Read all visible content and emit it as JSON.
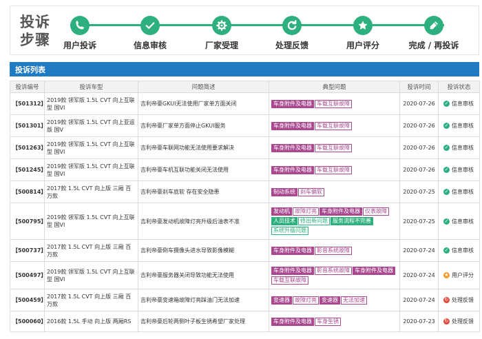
{
  "process": {
    "title": "投诉步骤",
    "steps": [
      {
        "label": "用户投诉",
        "icon": "phone-icon"
      },
      {
        "label": "信息审核",
        "icon": "check-icon"
      },
      {
        "label": "厂家受理",
        "icon": "gear-icon"
      },
      {
        "label": "处理反馈",
        "icon": "refresh-icon"
      },
      {
        "label": "用户评分",
        "icon": "star-icon"
      },
      {
        "label": "完成 / 再投诉",
        "icon": "pen-icon"
      }
    ]
  },
  "list": {
    "title": "投诉列表",
    "columns": [
      "投诉编号",
      "投诉车型",
      "问题简述",
      "典型问题",
      "投诉时间",
      "投诉状态"
    ],
    "rows": [
      {
        "id": "【501312】",
        "model": "2019款 领军版 1.5L CVT 向上互联型 国VI",
        "issue": "吉利帝豪GKUI无法使用厂家单方面关闭",
        "tags": [
          {
            "text": "车身附件及电器",
            "style": "solid"
          },
          {
            "text": "车载互联故障",
            "style": "outline"
          }
        ],
        "time": "2020-07-26",
        "status": "信息审核",
        "status_type": "ok"
      },
      {
        "id": "【501301】",
        "model": "2019款 领军版 1.5L CVT 向上亚运版 国V",
        "issue": "吉利帝豪厂家单方面停止GKUI服务",
        "tags": [
          {
            "text": "车身附件及电器",
            "style": "solid"
          },
          {
            "text": "车载互联故障",
            "style": "outline"
          }
        ],
        "time": "2020-07-26",
        "status": "信息审核",
        "status_type": "ok"
      },
      {
        "id": "【501263】",
        "model": "2019款 领军版 1.5L CVT 向上互联型 国VI",
        "issue": "吉利帝豪车联网功能无法使用要求解决",
        "tags": [
          {
            "text": "车身附件及电器",
            "style": "solid"
          },
          {
            "text": "车载互联故障",
            "style": "outline"
          }
        ],
        "time": "2020-07-26",
        "status": "信息审核",
        "status_type": "ok"
      },
      {
        "id": "【501245】",
        "model": "2019款 领军版 1.5L CVT 向上互联型 国VI",
        "issue": "吉利帝豪车机互联功能关闭无法使用",
        "tags": [
          {
            "text": "车身附件及电器",
            "style": "solid"
          },
          {
            "text": "车载互联故障",
            "style": "outline"
          }
        ],
        "time": "2020-07-26",
        "status": "信息审核",
        "status_type": "ok"
      },
      {
        "id": "【500814】",
        "model": "2017款 1.5L CVT 向上版 三厢 百万款",
        "issue": "吉利帝豪刹车底软 存在安全隐患",
        "tags": [
          {
            "text": "制动系统",
            "style": "solid"
          },
          {
            "text": "刹车偏软",
            "style": "outline"
          }
        ],
        "time": "2020-07-25",
        "status": "信息审核",
        "status_type": "ok"
      },
      {
        "id": "【500795】",
        "model": "2019款 领军版 1.5L CVT 向上互联型 国VI",
        "issue": "吉利帝豪发动机故障灯亮升级后油表不准",
        "tags": [
          {
            "text": "发动机",
            "style": "solid"
          },
          {
            "text": "故障灯亮",
            "style": "outline"
          },
          {
            "text": "车身附件及电器",
            "style": "solid"
          },
          {
            "text": "仪表故障",
            "style": "outline"
          },
          {
            "text": "人员技术",
            "style": "green-solid"
          },
          {
            "text": "修出新问题",
            "style": "green-outline"
          },
          {
            "text": "服务流程不完善",
            "style": "green-solid"
          },
          {
            "text": "系统升级问题",
            "style": "green-outline"
          }
        ],
        "time": "2020-07-25",
        "status": "信息审核",
        "status_type": "ok"
      },
      {
        "id": "【500737】",
        "model": "2017款 1.5L CVT 向上版 三厢 百万款",
        "issue": "吉利帝豪倒车摄像头进水导致影像模糊",
        "tags": [
          {
            "text": "车身附件及电器",
            "style": "solid"
          },
          {
            "text": "影音系统故障",
            "style": "outline"
          }
        ],
        "time": "2020-07-24",
        "status": "信息审核",
        "status_type": "ok"
      },
      {
        "id": "【500497】",
        "model": "2019款 领军版 1.5L CVT 向上互联型 国VI",
        "issue": "吉利帝豪服务器关闭导致功能无法使用",
        "tags": [
          {
            "text": "车身附件及电器",
            "style": "solid"
          },
          {
            "text": "影音系统故障",
            "style": "outline"
          },
          {
            "text": "车身附件及电器",
            "style": "solid"
          },
          {
            "text": "车载互联故障",
            "style": "outline"
          }
        ],
        "time": "2020-07-24",
        "status": "用户评分",
        "status_type": "rate"
      },
      {
        "id": "【500459】",
        "model": "2017款 1.5L CVT 向上版 三厢 百万款",
        "issue": "吉利帝豪变速箱故障灯亮踩油门无法加速",
        "tags": [
          {
            "text": "变速器",
            "style": "solid"
          },
          {
            "text": "故障灯亮",
            "style": "outline"
          },
          {
            "text": "变速器",
            "style": "solid"
          },
          {
            "text": "无法加速",
            "style": "outline"
          }
        ],
        "time": "2020-07-24",
        "status": "处理反馈",
        "status_type": "feedback"
      },
      {
        "id": "【500060】",
        "model": "2016款 1.5L 手动 向上版 两厢RS",
        "issue": "吉利帝豪后轮两侧叶子板生锈希望厂家处理",
        "tags": [
          {
            "text": "车身附件及电器",
            "style": "solid"
          },
          {
            "text": "车身生锈",
            "style": "outline"
          }
        ],
        "time": "2020-07-23",
        "status": "处理反馈",
        "status_type": "feedback"
      }
    ]
  },
  "colors": {
    "accent_green": "#2db07e",
    "bar_blue": "#1f7cc2",
    "tag_purple": "#a9478f",
    "status_ok": "#2db07e",
    "status_rate": "#f39c2b",
    "status_feedback": "#e0483b"
  }
}
